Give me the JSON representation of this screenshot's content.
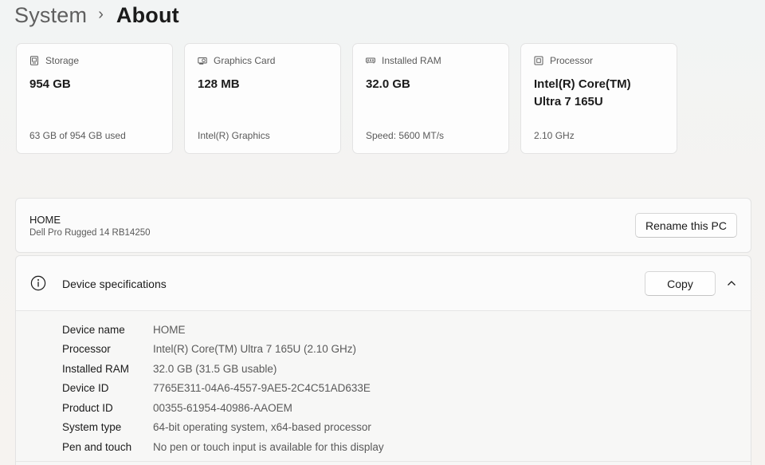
{
  "breadcrumb": {
    "parent": "System",
    "separator": "›",
    "current": "About"
  },
  "cards": [
    {
      "icon": "storage-icon",
      "label": "Storage",
      "value": "954 GB",
      "sub": "63 GB of 954 GB used"
    },
    {
      "icon": "graphics-card-icon",
      "label": "Graphics Card",
      "value": "128 MB",
      "sub": "Intel(R) Graphics"
    },
    {
      "icon": "ram-icon",
      "label": "Installed RAM",
      "value": "32.0 GB",
      "sub": "Speed: 5600 MT/s"
    },
    {
      "icon": "processor-icon",
      "label": "Processor",
      "value": "Intel(R) Core(TM)\nUltra 7 165U",
      "sub": "2.10 GHz"
    }
  ],
  "pc": {
    "name": "HOME",
    "model": "Dell Pro Rugged 14 RB14250",
    "rename_label": "Rename this PC"
  },
  "device_specs": {
    "title": "Device specifications",
    "copy_label": "Copy",
    "rows": [
      {
        "label": "Device name",
        "value": "HOME"
      },
      {
        "label": "Processor",
        "value": "Intel(R) Core(TM) Ultra 7 165U (2.10 GHz)"
      },
      {
        "label": "Installed RAM",
        "value": "32.0 GB (31.5 GB usable)"
      },
      {
        "label": "Device ID",
        "value": "7765E311-04A6-4557-9AE5-2C4C51AD633E"
      },
      {
        "label": "Product ID",
        "value": "00355-61954-40986-AAOEM"
      },
      {
        "label": "System type",
        "value": "64-bit operating system, x64-based processor"
      },
      {
        "label": "Pen and touch",
        "value": "No pen or touch input is available for this display"
      }
    ]
  },
  "colors": {
    "card_bg": "#fdfdfd",
    "border": "#e3e3e3",
    "secondary_text": "#5a5a5a"
  }
}
